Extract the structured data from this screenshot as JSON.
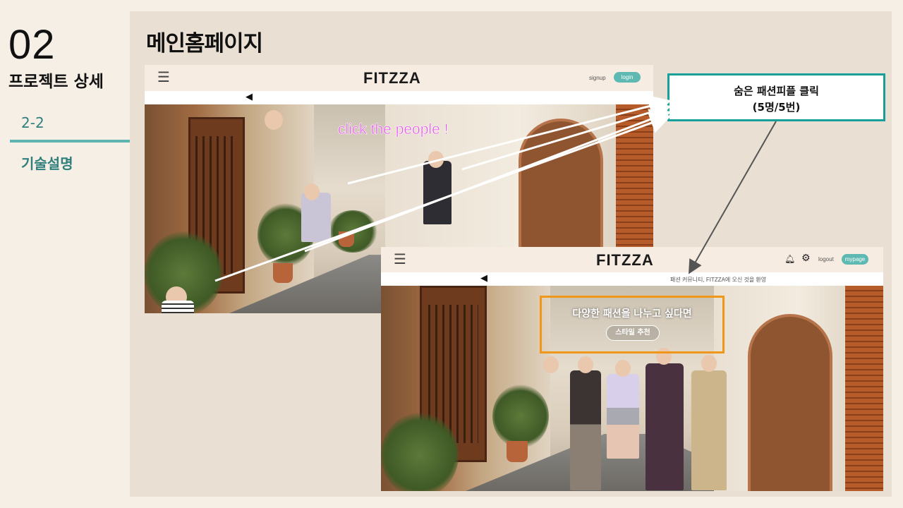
{
  "sidebar": {
    "section_number": "02",
    "section_title": "프로젝트 상세",
    "sub_number": "2-2",
    "sub_title": "기술설명"
  },
  "page_title": "메인홈페이지",
  "screenshot_before": {
    "brand": "FITZZA",
    "signup_label": "signup",
    "login_label": "login",
    "overlay_text": "click the people !"
  },
  "screenshot_after": {
    "brand": "FITZZA",
    "logout_label": "logout",
    "mypage_label": "mypage",
    "notice_text": "패션 커뮤니티, FITZZA에 오신 것을 환영",
    "banner_title": "다양한 패션을 나누고 싶다면",
    "banner_button": "스타일 추천"
  },
  "callout": {
    "line1": "숨은 패션피플 클릭",
    "line2": "(5명/5번)"
  },
  "colors": {
    "accent_teal": "#17a09a",
    "highlight_orange": "#f0961a",
    "overlay_magenta": "#e64ce6",
    "arrow_gray": "#555555"
  },
  "icons": [
    "hamburger-icon",
    "megaphone-icon",
    "bell-icon",
    "gear-icon"
  ]
}
